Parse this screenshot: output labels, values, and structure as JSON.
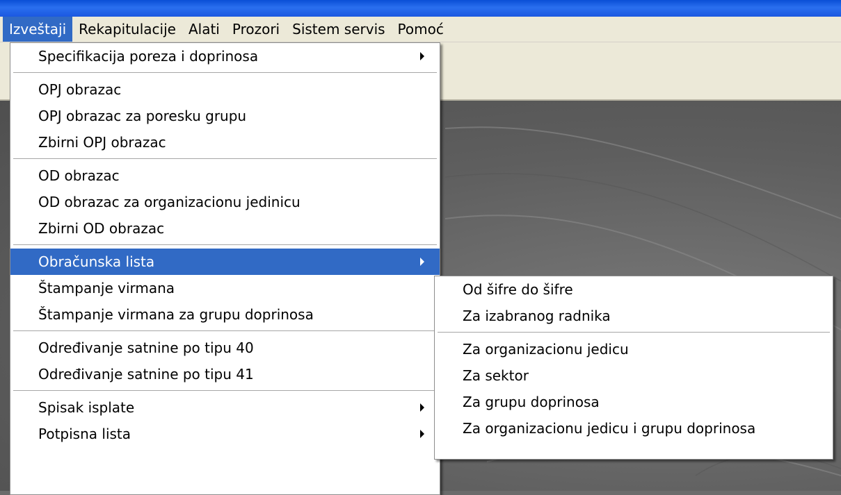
{
  "menubar": {
    "items": [
      {
        "label": "Izveštaji"
      },
      {
        "label": "Rekapitulacije"
      },
      {
        "label": "Alati"
      },
      {
        "label": "Prozori"
      },
      {
        "label": "Sistem servis"
      },
      {
        "label": "Pomoć"
      }
    ]
  },
  "main_menu": {
    "items": [
      "Specifikacija poreza i doprinosa",
      "OPJ obrazac",
      "OPJ obrazac za poresku grupu",
      "Zbirni OPJ obrazac",
      "OD obrazac",
      "OD obrazac za organizacionu jedinicu",
      "Zbirni OD obrazac",
      "Obračunska lista",
      "Štampanje virmana",
      "Štampanje virmana za grupu doprinosa",
      "Određivanje satnine po tipu 40",
      "Određivanje satnine po tipu 41",
      "Spisak isplate",
      "Potpisna lista"
    ]
  },
  "sub_menu": {
    "items": [
      "Od šifre do šifre",
      "Za izabranog radnika",
      "Za organizacionu jedicu",
      "Za sektor",
      "Za grupu doprinosa",
      "Za organizacionu jedicu i grupu doprinosa"
    ]
  },
  "colors": {
    "highlight": "#316ac5",
    "menubar_bg": "#ece9d8",
    "titlebar": "#1b58e0"
  }
}
